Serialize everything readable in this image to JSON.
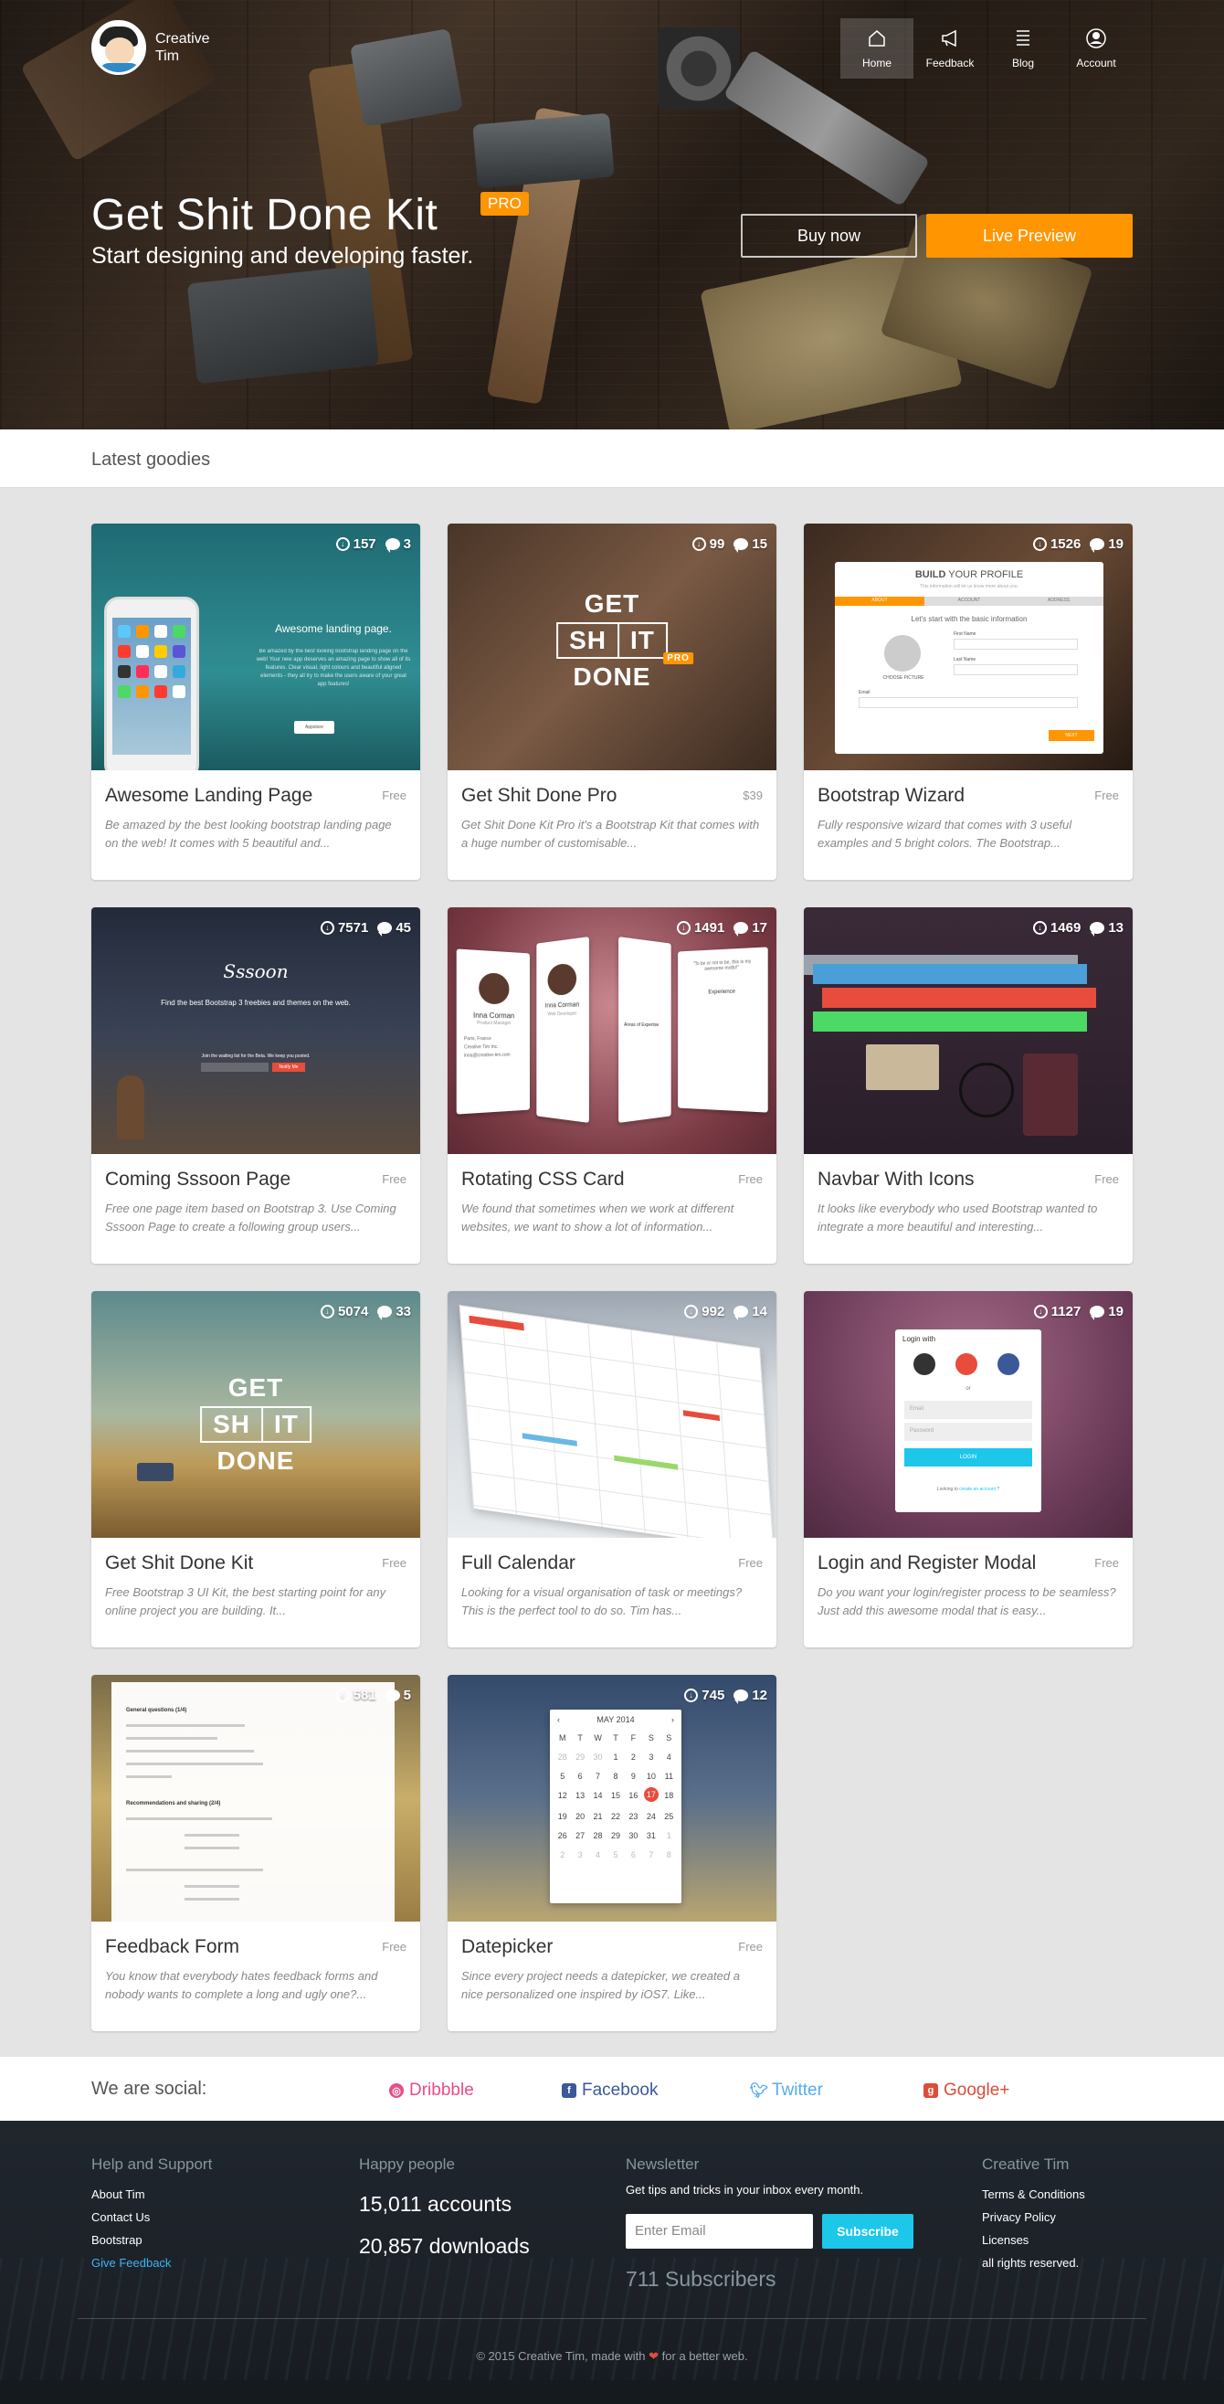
{
  "header": {
    "brand_line1": "Creative",
    "brand_line2": "Tim",
    "nav": [
      {
        "label": "Home",
        "icon": "home-icon"
      },
      {
        "label": "Feedback",
        "icon": "megaphone-icon"
      },
      {
        "label": "Blog",
        "icon": "list-icon"
      },
      {
        "label": "Account",
        "icon": "user-icon"
      }
    ]
  },
  "hero": {
    "title": "Get Shit Done Kit",
    "badge": "PRO",
    "subtitle": "Start designing and developing faster.",
    "buy_label": "Buy now",
    "preview_label": "Live Preview"
  },
  "section": {
    "title": "Latest goodies"
  },
  "cards": [
    {
      "title": "Awesome Landing Page",
      "price": "Free",
      "downloads": "157",
      "comments": "3",
      "desc": "Be amazed by the best looking bootstrap landing page on the web! It comes with 5 beautiful and..."
    },
    {
      "title": "Get Shit Done Pro",
      "price": "$39",
      "downloads": "99",
      "comments": "15",
      "desc": "Get Shit Done Kit Pro it's a Bootstrap Kit that comes with a huge number of customisable..."
    },
    {
      "title": "Bootstrap Wizard",
      "price": "Free",
      "downloads": "1526",
      "comments": "19",
      "desc": "Fully responsive wizard that comes with 3 useful examples and 5 bright colors. The Bootstrap..."
    },
    {
      "title": "Coming Sssoon Page",
      "price": "Free",
      "downloads": "7571",
      "comments": "45",
      "desc": "Free one page item based on Bootstrap 3. Use Coming Sssoon Page to create a following group users..."
    },
    {
      "title": "Rotating CSS Card",
      "price": "Free",
      "downloads": "1491",
      "comments": "17",
      "desc": "We found that sometimes when we work at different websites, we want to show a lot of information..."
    },
    {
      "title": "Navbar With Icons",
      "price": "Free",
      "downloads": "1469",
      "comments": "13",
      "desc": "It looks like everybody who used Bootstrap wanted to integrate a more beautiful and interesting..."
    },
    {
      "title": "Get Shit Done Kit",
      "price": "Free",
      "downloads": "5074",
      "comments": "33",
      "desc": "Free Bootstrap 3 UI Kit, the best starting point for any online project you are building. It..."
    },
    {
      "title": "Full Calendar",
      "price": "Free",
      "downloads": "992",
      "comments": "14",
      "desc": "Looking for a visual organisation of task or meetings? This is the perfect tool to do so. Tim has..."
    },
    {
      "title": "Login and Register Modal",
      "price": "Free",
      "downloads": "1127",
      "comments": "19",
      "desc": "Do you want your login/register process to be seamless? Just add this awesome modal that is easy..."
    },
    {
      "title": "Feedback Form",
      "price": "Free",
      "downloads": "581",
      "comments": "5",
      "desc": "You know that everybody hates feedback forms and nobody wants to complete a long and ugly one?..."
    },
    {
      "title": "Datepicker",
      "price": "Free",
      "downloads": "745",
      "comments": "12",
      "desc": "Since every project needs a datepicker, we created a nice personalized one inspired by iOS7. Like..."
    }
  ],
  "thumbs": {
    "landing_heading": "Awesome landing page.",
    "landing_text": "Be amazed by the best looking bootstrap landing page on the web! Your new app deserves an amazing page to show all of its features. Clear visual, light colours and beautiful aligned elements - they all try to make the users aware of your great app features!",
    "landing_btn": "Appstore",
    "gsd_words": [
      "GET",
      "SH",
      "IT",
      "DONE"
    ],
    "gsd_pro": "PRO",
    "wizard_title_bold": "BUILD",
    "wizard_title_rest": " YOUR PROFILE",
    "wizard_subtitle": "This information will let us know more about you.",
    "wizard_tabs": [
      "ABOUT",
      "ACCOUNT",
      "ADDRESS"
    ],
    "wizard_prompt": "Let's start with the basic information",
    "wizard_picture": "CHOOSE PICTURE",
    "wizard_fields": [
      "First Name",
      "Last Name",
      "Email"
    ],
    "wizard_next": "NEXT",
    "sssoon_logo": "Sssoon",
    "sssoon_text": "Find the best Bootstrap 3 freebies and themes on the web.",
    "sssoon_sub": "Join the waiting list for the Beta. We keep you posted.",
    "sssoon_btn": "Notify Me",
    "rot_name1": "Inna Corman",
    "rot_role1": "Product Manager",
    "rot_name2": "Inna Corman",
    "rot_role2": "Web Developer",
    "rot_details": [
      "Paris, France",
      "Creative Tim Inc.",
      "inna@creative-tim.com"
    ],
    "rot_quote": "\"To be or not to be, this is my awesome motto!\"",
    "rot_exp": "Experience",
    "rot_areas": "Areas of Expertise",
    "login_title": "Login with",
    "login_or": "or",
    "login_email": "Email",
    "login_password": "Password",
    "login_btn": "LOGIN",
    "login_foot": "Looking to",
    "login_link": "create an account",
    "form_section1": "General questions (1/4)",
    "form_section2": "Recommendations and sharing (2/4)",
    "dp_month": "MAY 2014",
    "dp_days": [
      "M",
      "T",
      "W",
      "T",
      "F",
      "S",
      "S"
    ],
    "dp_dates": [
      "28",
      "29",
      "30",
      "1",
      "2",
      "3",
      "4",
      "5",
      "6",
      "7",
      "8",
      "9",
      "10",
      "11",
      "12",
      "13",
      "14",
      "15",
      "16",
      "17",
      "18",
      "19",
      "20",
      "21",
      "22",
      "23",
      "24",
      "25",
      "26",
      "27",
      "28",
      "29",
      "30",
      "31",
      "1",
      "2",
      "3",
      "4",
      "5",
      "6",
      "7",
      "8"
    ],
    "dp_selected": "17"
  },
  "social": {
    "label": "We are social:",
    "links": [
      {
        "label": "Dribbble",
        "color": "#ea4c89"
      },
      {
        "label": "Facebook",
        "color": "#3b5998"
      },
      {
        "label": "Twitter",
        "color": "#55acee"
      },
      {
        "label": "Google+",
        "color": "#dd4b39"
      }
    ]
  },
  "footer": {
    "help_title": "Help and Support",
    "help_links": [
      "About Tim",
      "Contact Us",
      "Bootstrap",
      "Give Feedback"
    ],
    "people_title": "Happy people",
    "accounts": "15,011 accounts",
    "downloads": "20,857 downloads",
    "newsletter_title": "Newsletter",
    "newsletter_text": "Get tips and tricks in your inbox every month.",
    "email_placeholder": "Enter Email",
    "subscribe_label": "Subscribe",
    "subscribers": "711 Subscribers",
    "company_title": "Creative Tim",
    "company_links": [
      "Terms & Conditions",
      "Privacy Policy",
      "Licenses",
      "all rights reserved."
    ],
    "copyright_pre": "© 2015 Creative Tim, made with",
    "copyright_post": "for a better web."
  },
  "colors": {
    "accent": "#ff9500",
    "link_blue": "#3fb3f0",
    "subscribe": "#1dc7ea"
  }
}
